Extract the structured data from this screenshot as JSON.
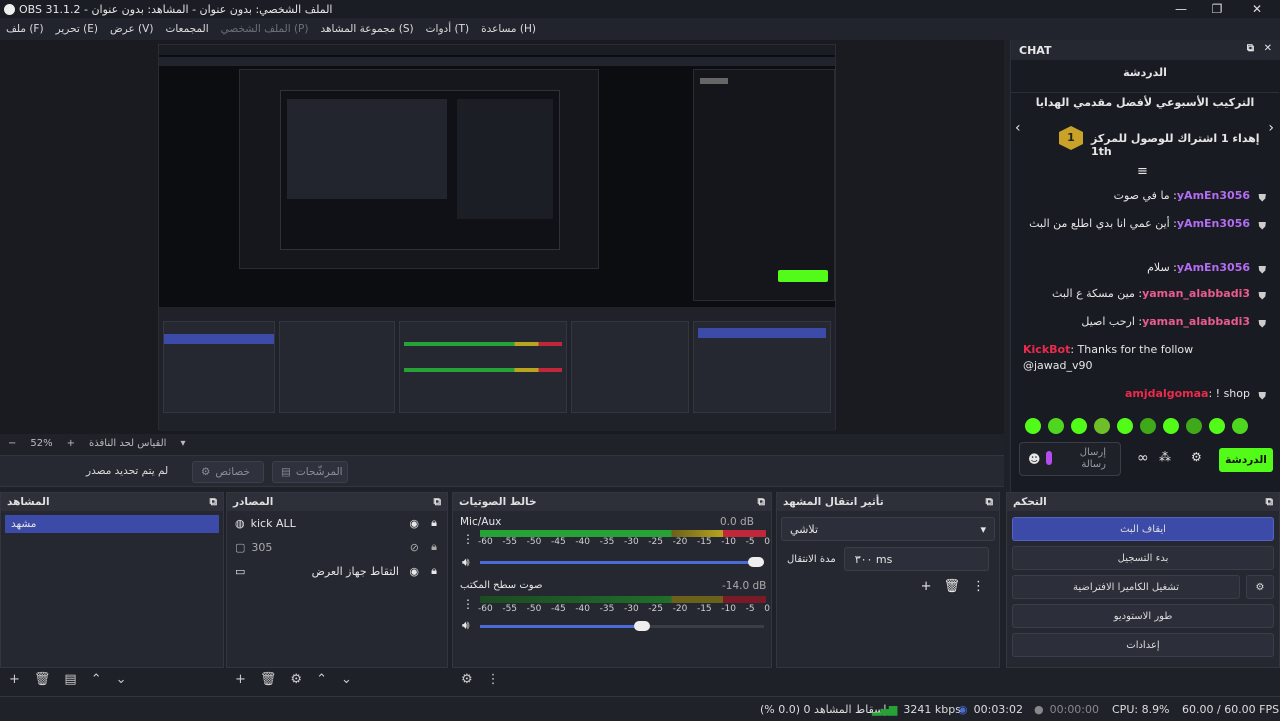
{
  "window": {
    "title": "OBS 31.1.2 - الملف الشخصي: بدون عنوان - المشاهد: بدون عنوان"
  },
  "menu": [
    {
      "label": "ملف (F)",
      "enabled": true
    },
    {
      "label": "تحرير (E)",
      "enabled": true
    },
    {
      "label": "عرض (V)",
      "enabled": true
    },
    {
      "label": "المجمعات",
      "enabled": true
    },
    {
      "label": "الملف الشخصي (P)",
      "enabled": false
    },
    {
      "label": "مجموعة المشاهد (S)",
      "enabled": true
    },
    {
      "label": "أدوات (T)",
      "enabled": true
    },
    {
      "label": "مساعدة (H)",
      "enabled": true
    }
  ],
  "preview": {
    "zoom": "52%",
    "scale_label": "القياس لحد النافذة"
  },
  "preview_toolbar": {
    "no_source": "لم يتم تحديد مصدر",
    "properties": "خصائص",
    "filters": "المرشّحات"
  },
  "chat": {
    "title": "CHAT",
    "tab": "الدردشة",
    "leaderboard_title": "التركيب الأسبوعي لأفضل مقدمي الهدايا",
    "leaderboard_entry": "إهداء 1 اشتراك للوصول للمركز 1th",
    "rank": "1",
    "messages": [
      {
        "user": "yAmEn3056",
        "text": "ما في صوت",
        "color": "purple"
      },
      {
        "user": "yAmEn3056",
        "text": "أين عمي انا بدي اطلع من البث",
        "color": "purple"
      },
      {
        "user": "yAmEn3056",
        "text": "سلام",
        "color": "purple"
      },
      {
        "user": "yaman_alabbadi3",
        "text": "مين مسكة ع البث",
        "color": "pink"
      },
      {
        "user": "yaman_alabbadi3",
        "text": "ارحب اصيل",
        "color": "pink"
      },
      {
        "user": "KickBot",
        "text": "Thanks for the follow @jawad_v90",
        "color": "red"
      },
      {
        "user": "amjdalgomaa",
        "text": "! shop",
        "color": "red"
      }
    ],
    "send_placeholder": "إرسال رسالة",
    "send_button": "الدردشة"
  },
  "scenes": {
    "title": "المشاهد",
    "items": [
      "مشهد"
    ]
  },
  "sources": {
    "title": "المصادر",
    "items": [
      {
        "name": "kick ALL",
        "icon": "browser-icon",
        "visible": true
      },
      {
        "name": "305",
        "icon": "image-icon",
        "visible": false
      },
      {
        "name": "التقاط جهاز العرض",
        "icon": "monitor-icon",
        "visible": true
      }
    ]
  },
  "mixer": {
    "title": "خالط الصوتيات",
    "channels": [
      {
        "name": "Mic/Aux",
        "db": "0.0 dB",
        "volume": 1.0
      },
      {
        "name": "صوت سطح المكتب",
        "db": "-14.0 dB",
        "volume": 0.57
      }
    ],
    "ticks": [
      "-60",
      "-55",
      "-50",
      "-45",
      "-40",
      "-35",
      "-30",
      "-25",
      "-20",
      "-15",
      "-10",
      "-5",
      "0"
    ]
  },
  "transitions": {
    "title": "تأثير انتقال المشهد",
    "selected": "تلاشي",
    "duration_label": "مدة الانتقال",
    "duration_value": "٣٠٠ ms"
  },
  "controls": {
    "title": "التحكم",
    "buttons": [
      "ايقاف البث",
      "بدء التسجيل",
      "تشغيل الكاميرا الافتراضية",
      "طور الاستوديو",
      "إعدادات"
    ]
  },
  "status": {
    "dropped": "إسقاط المشاهد 0 (0.0 %)",
    "bitrate": "3241 kbps",
    "stream_time": "00:03:02",
    "rec_time": "00:00:00",
    "cpu": "CPU: 8.9%",
    "fps": "60.00 / 60.00 FPS"
  },
  "colors": {
    "accent": "#3d4ba8",
    "kick_green": "#53fc18",
    "meter_green": "#27a237",
    "meter_yellow": "#b8a41e",
    "meter_red": "#c0283a"
  }
}
